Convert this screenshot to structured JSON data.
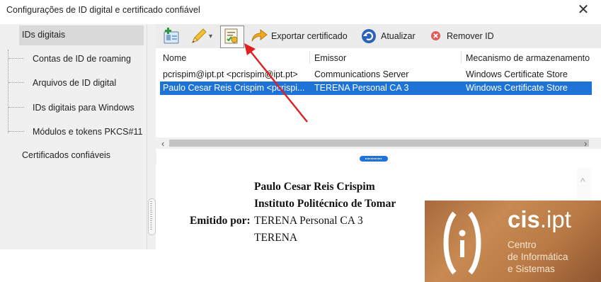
{
  "window": {
    "title": "Configurações de ID digital e certificado confiável",
    "close_glyph": "✕"
  },
  "sidebar": {
    "items": [
      {
        "label": "IDs digitais",
        "selected": true
      },
      {
        "label": "Contas de ID de roaming"
      },
      {
        "label": "Arquivos de ID digital"
      },
      {
        "label": "IDs digitais para Windows"
      },
      {
        "label": "Módulos e tokens PKCS#11"
      },
      {
        "label": "Certificados confiáveis"
      }
    ]
  },
  "toolbar": {
    "icons": [
      "add-id-icon",
      "pencil-icon",
      "certificate-usage-icon",
      "export-arrow-icon",
      "refresh-icon",
      "remove-icon"
    ],
    "export_label": "Exportar certificado",
    "refresh_label": "Atualizar",
    "remove_label": "Remover ID",
    "dropdown_glyph": "▾"
  },
  "table": {
    "columns": [
      "Nome",
      "Emissor",
      "Mecanismo de armazenamento"
    ],
    "rows": [
      {
        "name": "pcrispim@ipt.pt <pcrispim@ipt.pt>",
        "issuer": "Communications Server",
        "storage": "Windows Certificate Store",
        "selected": false
      },
      {
        "name": "Paulo Cesar Reis Crispim <pcrispi...",
        "issuer": "TERENA Personal CA 3",
        "storage": "Windows Certificate Store",
        "selected": true
      }
    ],
    "scroll_left": "‹",
    "scroll_right": "›"
  },
  "details": {
    "name": "Paulo Cesar Reis Crispim",
    "org": "Instituto Politécnico de Tomar",
    "issued_by_label": "Emitido por:",
    "issuer_line1": "TERENA Personal CA 3",
    "issuer_line2": "TERENA",
    "scroll_up": "^"
  },
  "logo": {
    "brand_main": "cis",
    "brand_dot": ".ipt",
    "line1": "Centro",
    "line2": "de Informática",
    "line3": "e Sistemas"
  },
  "colors": {
    "selection": "#1e73d8",
    "annotation_arrow": "#e02020",
    "logo_background": "#b97a45"
  }
}
